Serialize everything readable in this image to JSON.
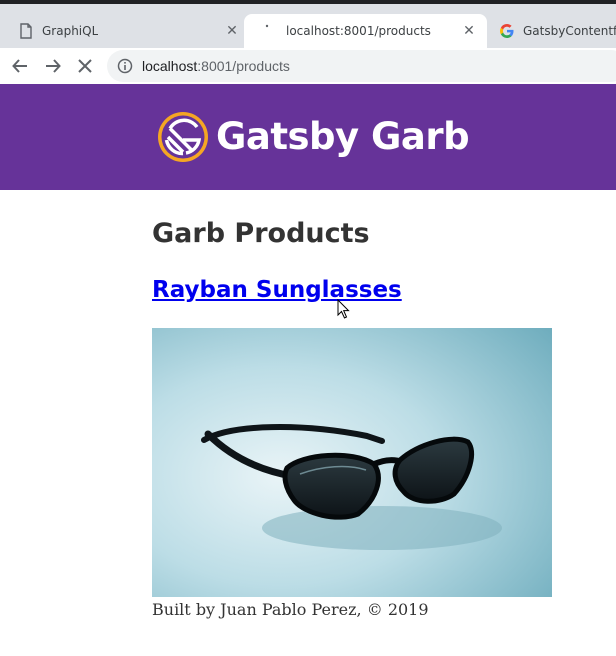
{
  "browser": {
    "tabs": [
      {
        "title": "GraphiQL",
        "icon": "document-icon",
        "active": false
      },
      {
        "title": "localhost:8001/products",
        "icon": "loading-icon",
        "active": true
      },
      {
        "title": "GatsbyContentfulF",
        "icon": "google-icon",
        "active": false
      }
    ],
    "tab_close_glyph": "✕",
    "address": {
      "host": "localhost",
      "path": ":8001/products"
    },
    "colors": {
      "tabstrip": "#dee1e6",
      "omnibox": "#f1f3f4"
    }
  },
  "site": {
    "title": "Gatsby Garb",
    "logo_icon": "gatsby-logo-icon",
    "header_color": "#663399",
    "logo_color": "#f5a623"
  },
  "main": {
    "heading": "Garb Products",
    "products": [
      {
        "name": "Rayban Sunglasses",
        "image_icon": "sunglasses-photo"
      }
    ]
  },
  "footer": {
    "text": "Built by Juan Pablo Perez, © 2019"
  }
}
